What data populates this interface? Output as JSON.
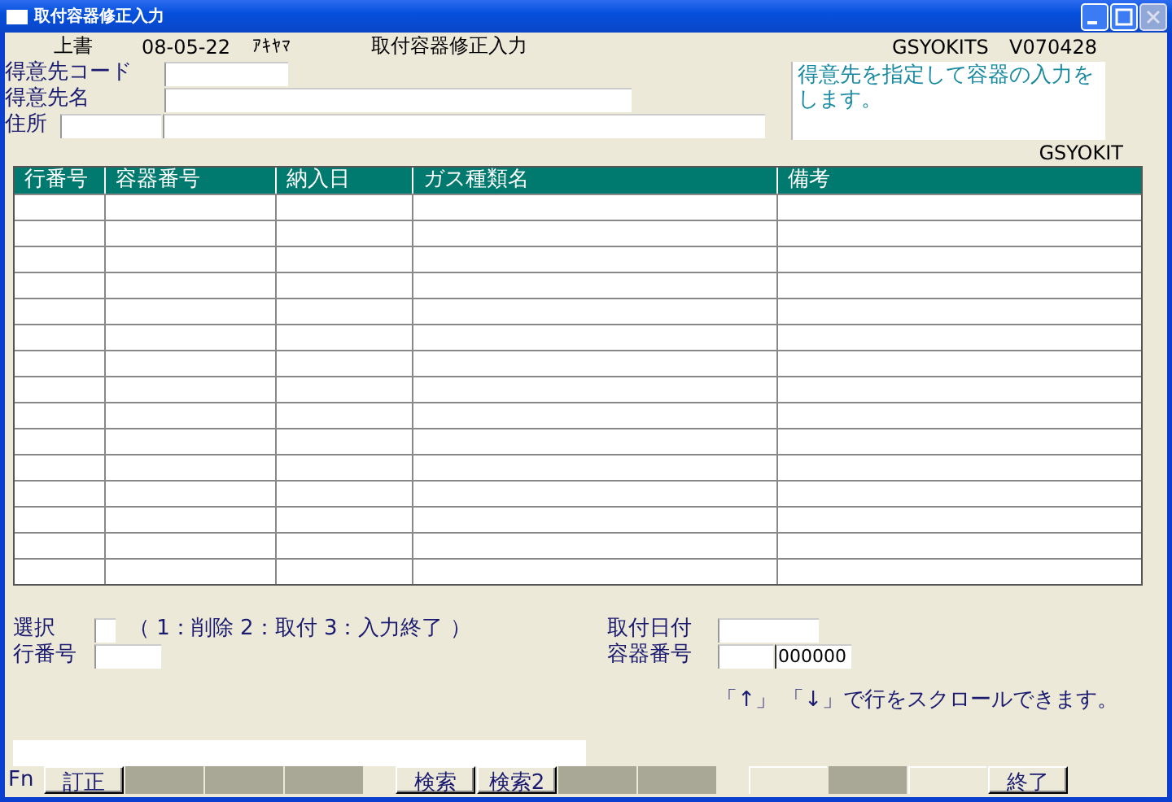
{
  "window": {
    "title": "取付容器修正入力"
  },
  "header": {
    "mode": "上書",
    "date": "08-05-22",
    "user": "ｱｷﾔﾏ",
    "screen_title": "取付容器修正入力",
    "program_id": "GSYOKITS",
    "version": "V070428"
  },
  "customer_fields": [
    {
      "kind": "code",
      "label": "得意先コード"
    },
    {
      "kind": "name",
      "label": "得意先名"
    },
    {
      "kind": "address",
      "label": "住所"
    }
  ],
  "message": "得意先を指定して容器の入力をします。",
  "form_id": "GSYOKIT",
  "table": {
    "columns": [
      "行番号",
      "容器番号",
      "納入日",
      "ガス種類名",
      "備考"
    ]
  },
  "selection": {
    "label": "選択",
    "hint": "（ 1：削除  2：取付  3：入力終了 ）"
  },
  "row_number": {
    "label": "行番号"
  },
  "install_date": {
    "label": "取付日付"
  },
  "container_number": {
    "label": "容器番号",
    "value": "000000"
  },
  "scroll_hint": "「↑」 「↓」で行をスクロールできます。",
  "function_keys": {
    "prefix": "Fn",
    "keys": [
      {
        "kind": "key",
        "label": "訂正"
      },
      {
        "kind": "gray"
      },
      {
        "kind": "gray"
      },
      {
        "kind": "gray"
      },
      {
        "kind": "gap"
      },
      {
        "kind": "key",
        "label": "検索"
      },
      {
        "kind": "key",
        "label": "検索2"
      },
      {
        "kind": "gray"
      },
      {
        "kind": "gray"
      },
      {
        "kind": "gap"
      },
      {
        "kind": "light"
      },
      {
        "kind": "gray"
      },
      {
        "kind": "light"
      },
      {
        "kind": "key",
        "label": "終了"
      }
    ]
  }
}
